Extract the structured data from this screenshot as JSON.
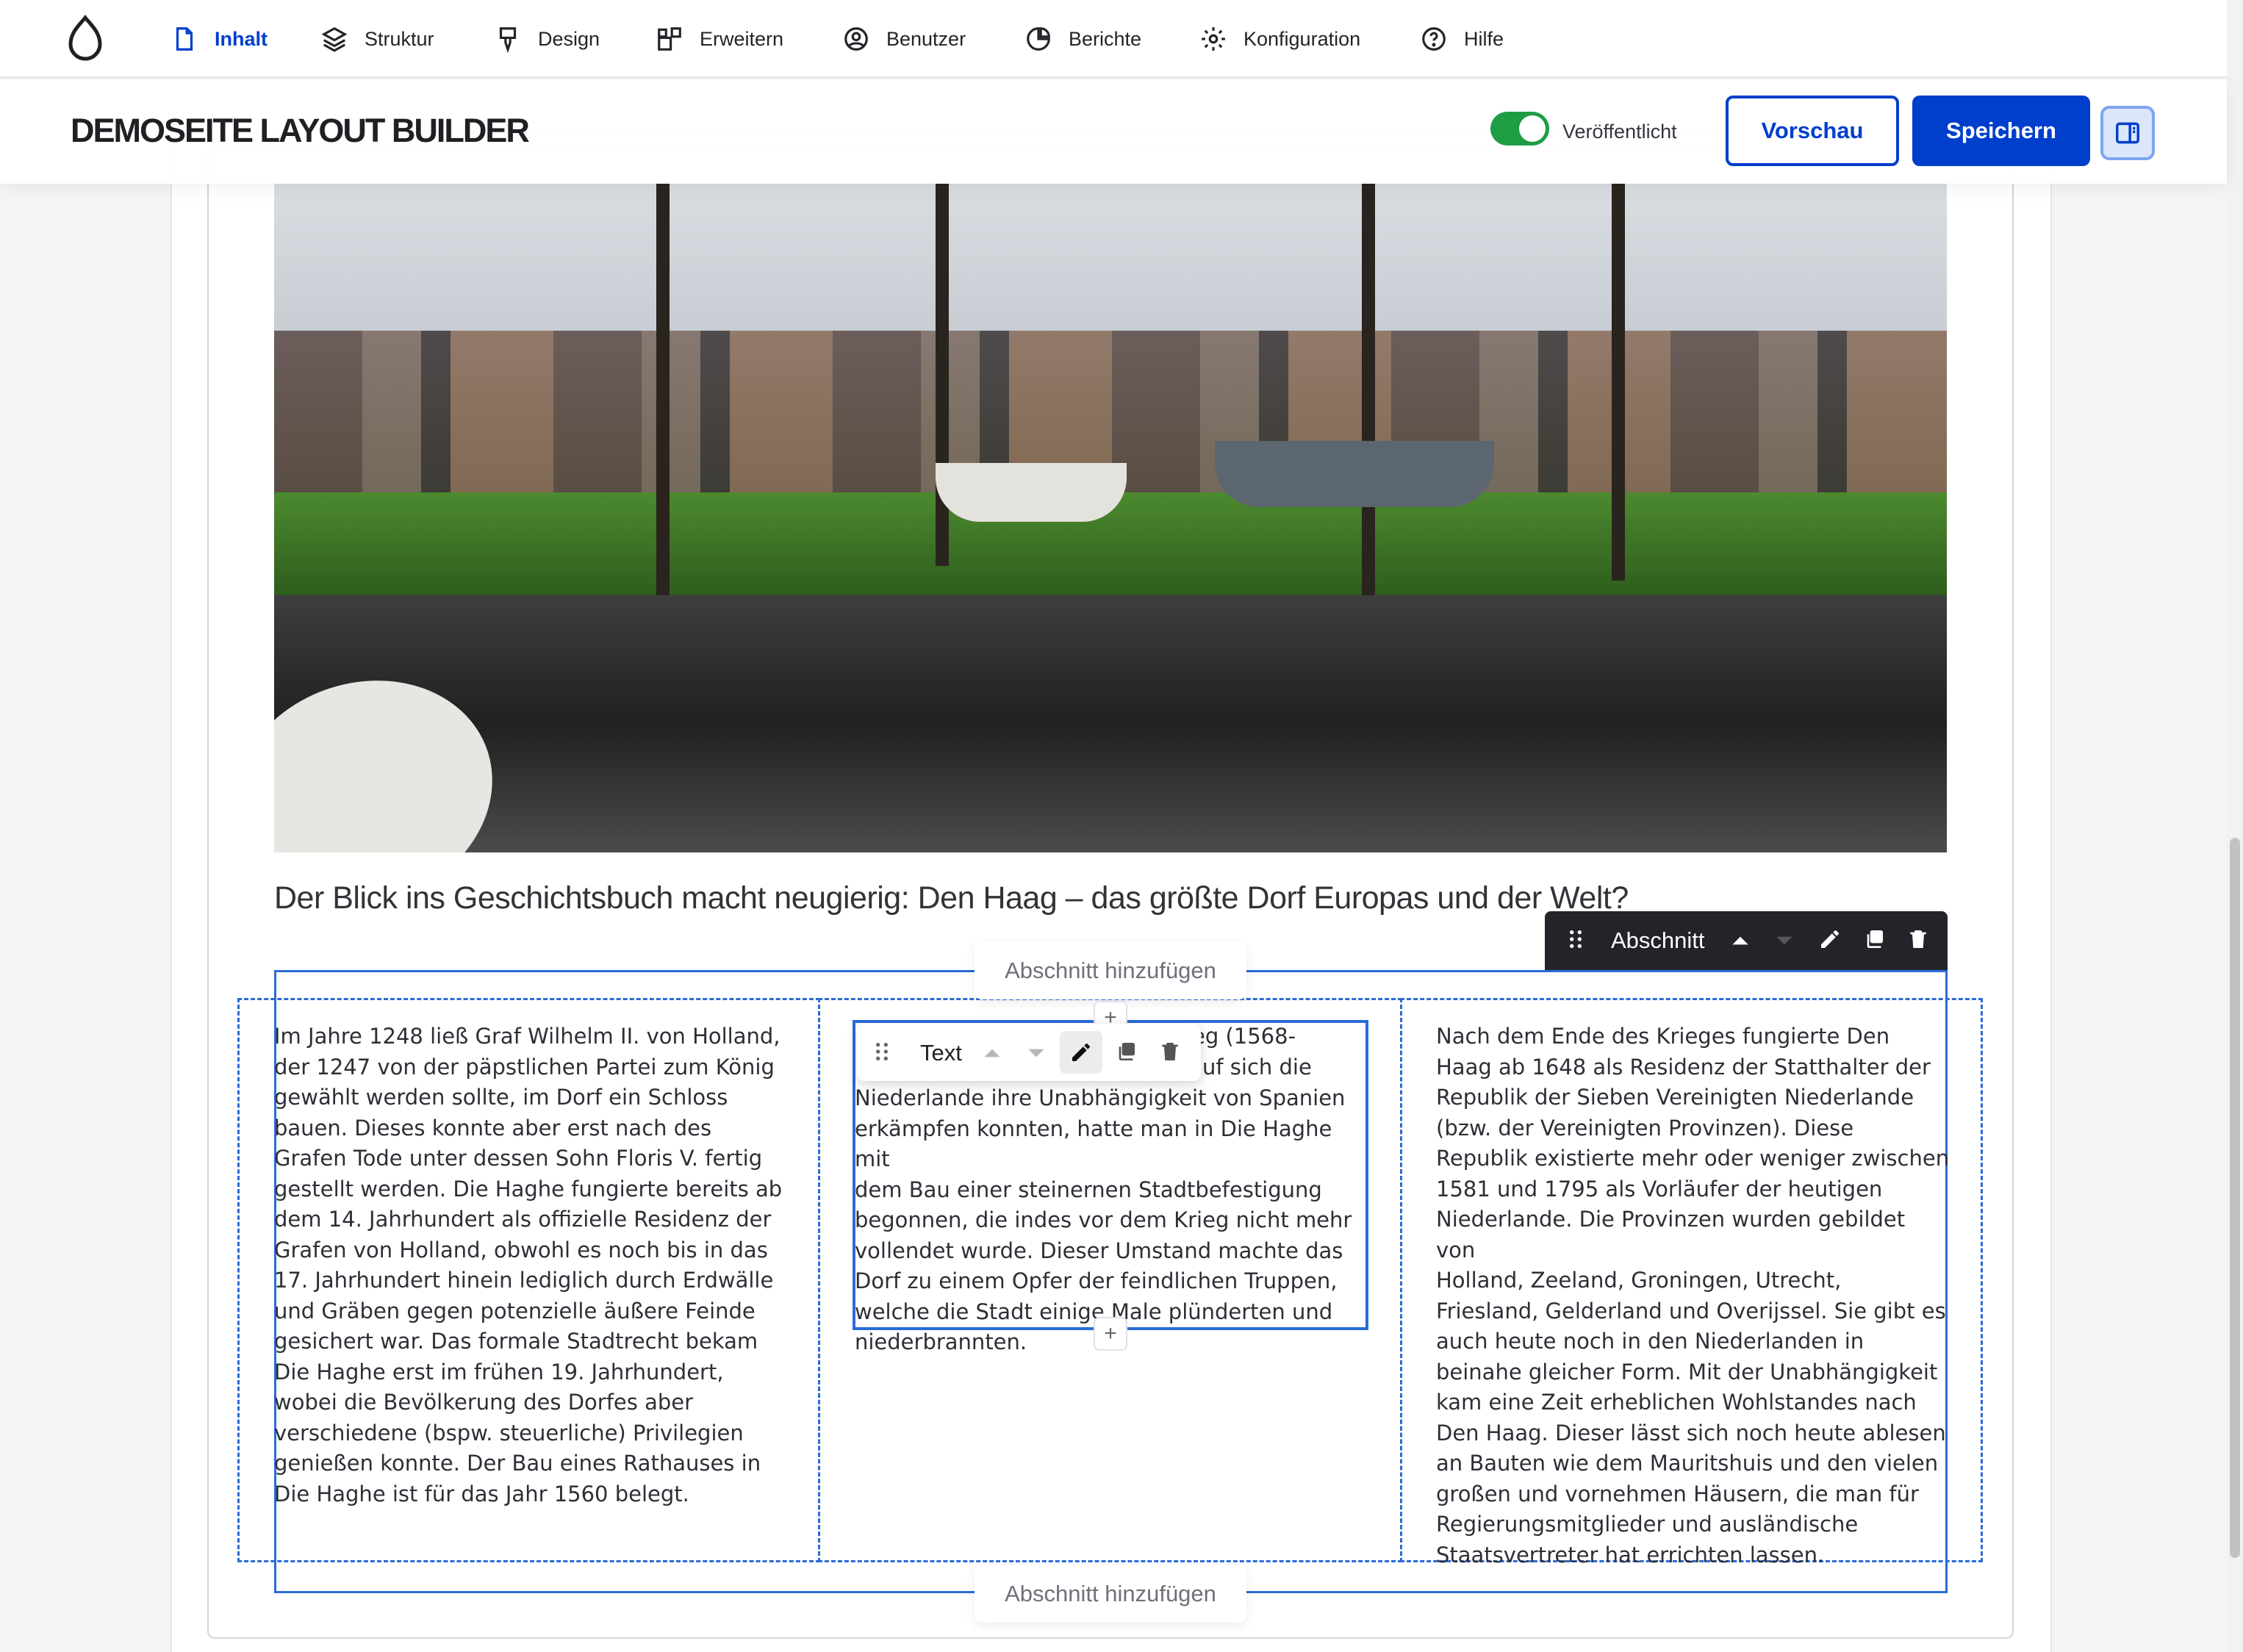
{
  "nav": {
    "items": [
      {
        "label": "Inhalt",
        "icon": "file-icon",
        "active": true
      },
      {
        "label": "Struktur",
        "icon": "layers-icon"
      },
      {
        "label": "Design",
        "icon": "brush-icon"
      },
      {
        "label": "Erweitern",
        "icon": "puzzle-icon"
      },
      {
        "label": "Benutzer",
        "icon": "user-icon"
      },
      {
        "label": "Berichte",
        "icon": "chart-pie-icon"
      },
      {
        "label": "Konfiguration",
        "icon": "gear-icon"
      },
      {
        "label": "Hilfe",
        "icon": "help-icon"
      }
    ]
  },
  "titlebar": {
    "page_title": "DEMOSEITE LAYOUT BUILDER",
    "published_label": "Veröffentlicht",
    "published": true,
    "preview_label": "Vorschau",
    "save_label": "Speichern"
  },
  "content": {
    "headline": "Der Blick ins Geschichtsbuch macht neugierig: Den Haag – das größte Dorf Europas und der Welt?",
    "add_section_label": "Abschnitt hinzufügen",
    "section_toolbar_label": "Abschnitt",
    "block_toolbar_label": "Text",
    "col1": "Im Jahre 1248 ließ Graf Wilhelm II. von Holland,\nder 1247 von der päpstlichen Partei zum König\ngewählt werden sollte, im Dorf ein Schloss\nbauen. Dieses konnte aber erst nach des\nGrafen Tode unter dessen Sohn Floris V. fertig\ngestellt werden. Die Haghe fungierte bereits ab\ndem 14. Jahrhundert als offizielle Residenz der\nGrafen von Holland, obwohl es noch bis in das\n17. Jahrhundert hinein lediglich durch Erdwälle\nund Gräben gegen potenzielle äußere Feinde\ngesichert war. Das formale Stadtrecht bekam\nDie Haghe erst im frühen 19. Jahrhundert,\nwobei die Bevölkerung des Dorfes aber\nverschiedene (bspw. steuerliche) Privilegien\ngenießen konnte. Der Bau eines Rathauses in\nDie Haghe ist für das Jahr 1560 belegt.",
    "col2_visible_top1": "rieg (1568-",
    "col2_visible_top2": "uf sich die",
    "col2_rest": "Niederlande ihre Unabhängigkeit von Spanien\nerkämpfen konnten, hatte man in Die Haghe mit\ndem Bau einer steinernen Stadtbefestigung\nbegonnen, die indes vor dem Krieg nicht mehr\nvollendet wurde. Dieser Umstand machte das\nDorf zu einem Opfer der feindlichen Truppen,\nwelche die Stadt einige Male plünderten und\nniederbrannten.",
    "col3": "Nach dem Ende des Krieges fungierte Den\nHaag ab 1648 als Residenz der Statthalter der\nRepublik der Sieben Vereinigten Niederlande\n(bzw. der Vereinigten Provinzen). Diese\nRepublik existierte mehr oder weniger zwischen\n1581 und 1795 als Vorläufer der heutigen\nNiederlande. Die Provinzen wurden gebildet von\nHolland, Zeeland, Groningen, Utrecht,\nFriesland, Gelderland und Overijssel. Sie gibt es\nauch heute noch in den Niederlanden in\nbeinahe gleicher Form. Mit der Unabhängigkeit\nkam eine Zeit erheblichen Wohlstandes nach\nDen Haag. Dieser lässt sich noch heute ablesen\nan Bauten wie dem Mauritshuis und den vielen\ngroßen und vornehmen Häusern, die man für\nRegierungsmitglieder und ausländische\nStaatsvertreter hat errichten lassen."
  },
  "colors": {
    "accent": "#003ecc",
    "outline": "#2b6bd8",
    "toggle_on": "#1e9d45",
    "toolbar_dark": "#232429"
  }
}
